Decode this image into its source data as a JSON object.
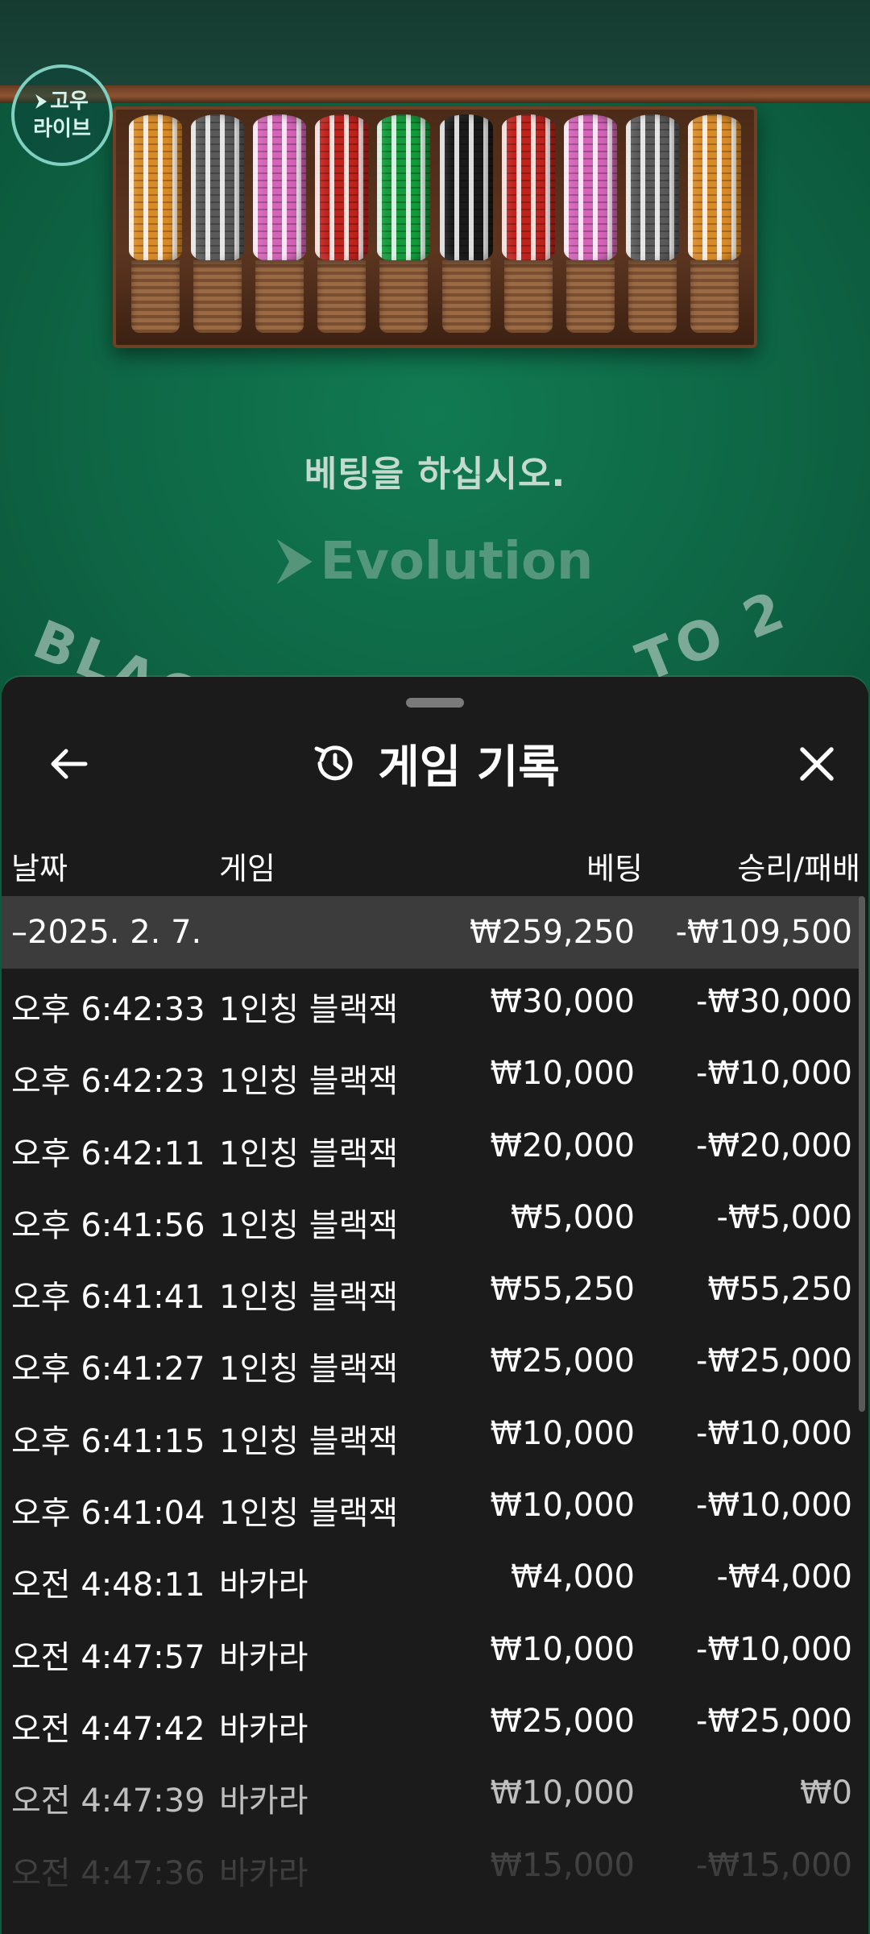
{
  "table": {
    "logo_line1": "고우",
    "logo_line2": "라이브",
    "prompt": "베팅을 하십시오.",
    "provider": "Evolution",
    "arc_left": "BLAC",
    "arc_right": "TO 2",
    "chip_colors": [
      "#d98a28",
      "#5a5a5a",
      "#d464b8",
      "#c0221c",
      "#139a3a",
      "#1a1a1a",
      "#c0221c",
      "#d464b8",
      "#5a5a5a",
      "#d98a28"
    ]
  },
  "sheet": {
    "title": "게임 기록",
    "back_icon": "arrow-left-icon",
    "history_icon": "history-icon",
    "close_icon": "close-icon",
    "columns": {
      "date": "날짜",
      "game": "게임",
      "bet": "베팅",
      "win_loss": "승리/패배"
    },
    "day": {
      "date": "–2025. 2. 7.",
      "bet": "₩259,250",
      "win_loss": "-₩109,500"
    },
    "rows": [
      {
        "time": "오후 6:42:33",
        "game": "1인칭 블랙잭",
        "bet": "₩30,000",
        "win_loss": "-₩30,000"
      },
      {
        "time": "오후 6:42:23",
        "game": "1인칭 블랙잭",
        "bet": "₩10,000",
        "win_loss": "-₩10,000"
      },
      {
        "time": "오후 6:42:11",
        "game": "1인칭 블랙잭",
        "bet": "₩20,000",
        "win_loss": "-₩20,000"
      },
      {
        "time": "오후 6:41:56",
        "game": "1인칭 블랙잭",
        "bet": "₩5,000",
        "win_loss": "-₩5,000"
      },
      {
        "time": "오후 6:41:41",
        "game": "1인칭 블랙잭",
        "bet": "₩55,250",
        "win_loss": "₩55,250"
      },
      {
        "time": "오후 6:41:27",
        "game": "1인칭 블랙잭",
        "bet": "₩25,000",
        "win_loss": "-₩25,000"
      },
      {
        "time": "오후 6:41:15",
        "game": "1인칭 블랙잭",
        "bet": "₩10,000",
        "win_loss": "-₩10,000"
      },
      {
        "time": "오후 6:41:04",
        "game": "1인칭 블랙잭",
        "bet": "₩10,000",
        "win_loss": "-₩10,000"
      },
      {
        "time": "오전 4:48:11",
        "game": "바카라",
        "bet": "₩4,000",
        "win_loss": "-₩4,000"
      },
      {
        "time": "오전 4:47:57",
        "game": "바카라",
        "bet": "₩10,000",
        "win_loss": "-₩10,000"
      },
      {
        "time": "오전 4:47:42",
        "game": "바카라",
        "bet": "₩25,000",
        "win_loss": "-₩25,000"
      },
      {
        "time": "오전 4:47:39",
        "game": "바카라",
        "bet": "₩10,000",
        "win_loss": "₩0"
      },
      {
        "time": "오전 4:47:36",
        "game": "바카라",
        "bet": "₩15,000",
        "win_loss": "-₩15,000"
      }
    ]
  }
}
